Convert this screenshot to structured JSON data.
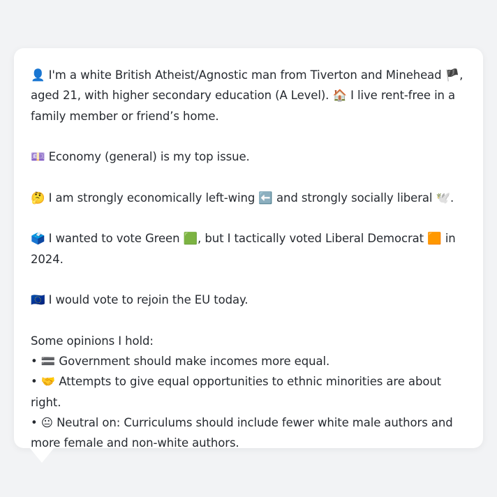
{
  "message": {
    "p1": {
      "icon": "👤",
      "text": "I'm a white British Atheist/Agnostic man from Tiverton and Minehead",
      "flag": "🏴",
      "text2": ", aged 21, with higher secondary education (A Level).",
      "home_icon": "🏠",
      "text3": "I live rent-free in a family member or friend’s home."
    },
    "p2": {
      "icon": "💷",
      "text": "Economy (general) is my top issue."
    },
    "p3": {
      "icon": "🤔",
      "text": "I am strongly economically left-wing",
      "left_icon": "⬅️",
      "text2": "and strongly socially liberal",
      "dove_icon": "🕊️",
      "text3": "."
    },
    "p4": {
      "icon": "🗳️",
      "text": "I wanted to vote Green",
      "green_icon": "🟩",
      "text2": ", but I tactically voted Liberal Democrat",
      "orange_icon": "🟧",
      "text3": "in 2024."
    },
    "p5": {
      "icon": "🇪🇺",
      "text": "I would vote to rejoin the EU today."
    },
    "opinions": {
      "heading": "Some opinions I hold:",
      "items": [
        {
          "bullet": "•",
          "icon": "🟰",
          "text": "Government should make incomes more equal."
        },
        {
          "bullet": "•",
          "icon": "🤝",
          "text": "Attempts to give equal opportunities to ethnic minorities are about right."
        },
        {
          "bullet": "•",
          "icon": "😐",
          "text": "Neutral on: Curriculums should include fewer white male authors and more female and non-white authors."
        }
      ]
    }
  }
}
